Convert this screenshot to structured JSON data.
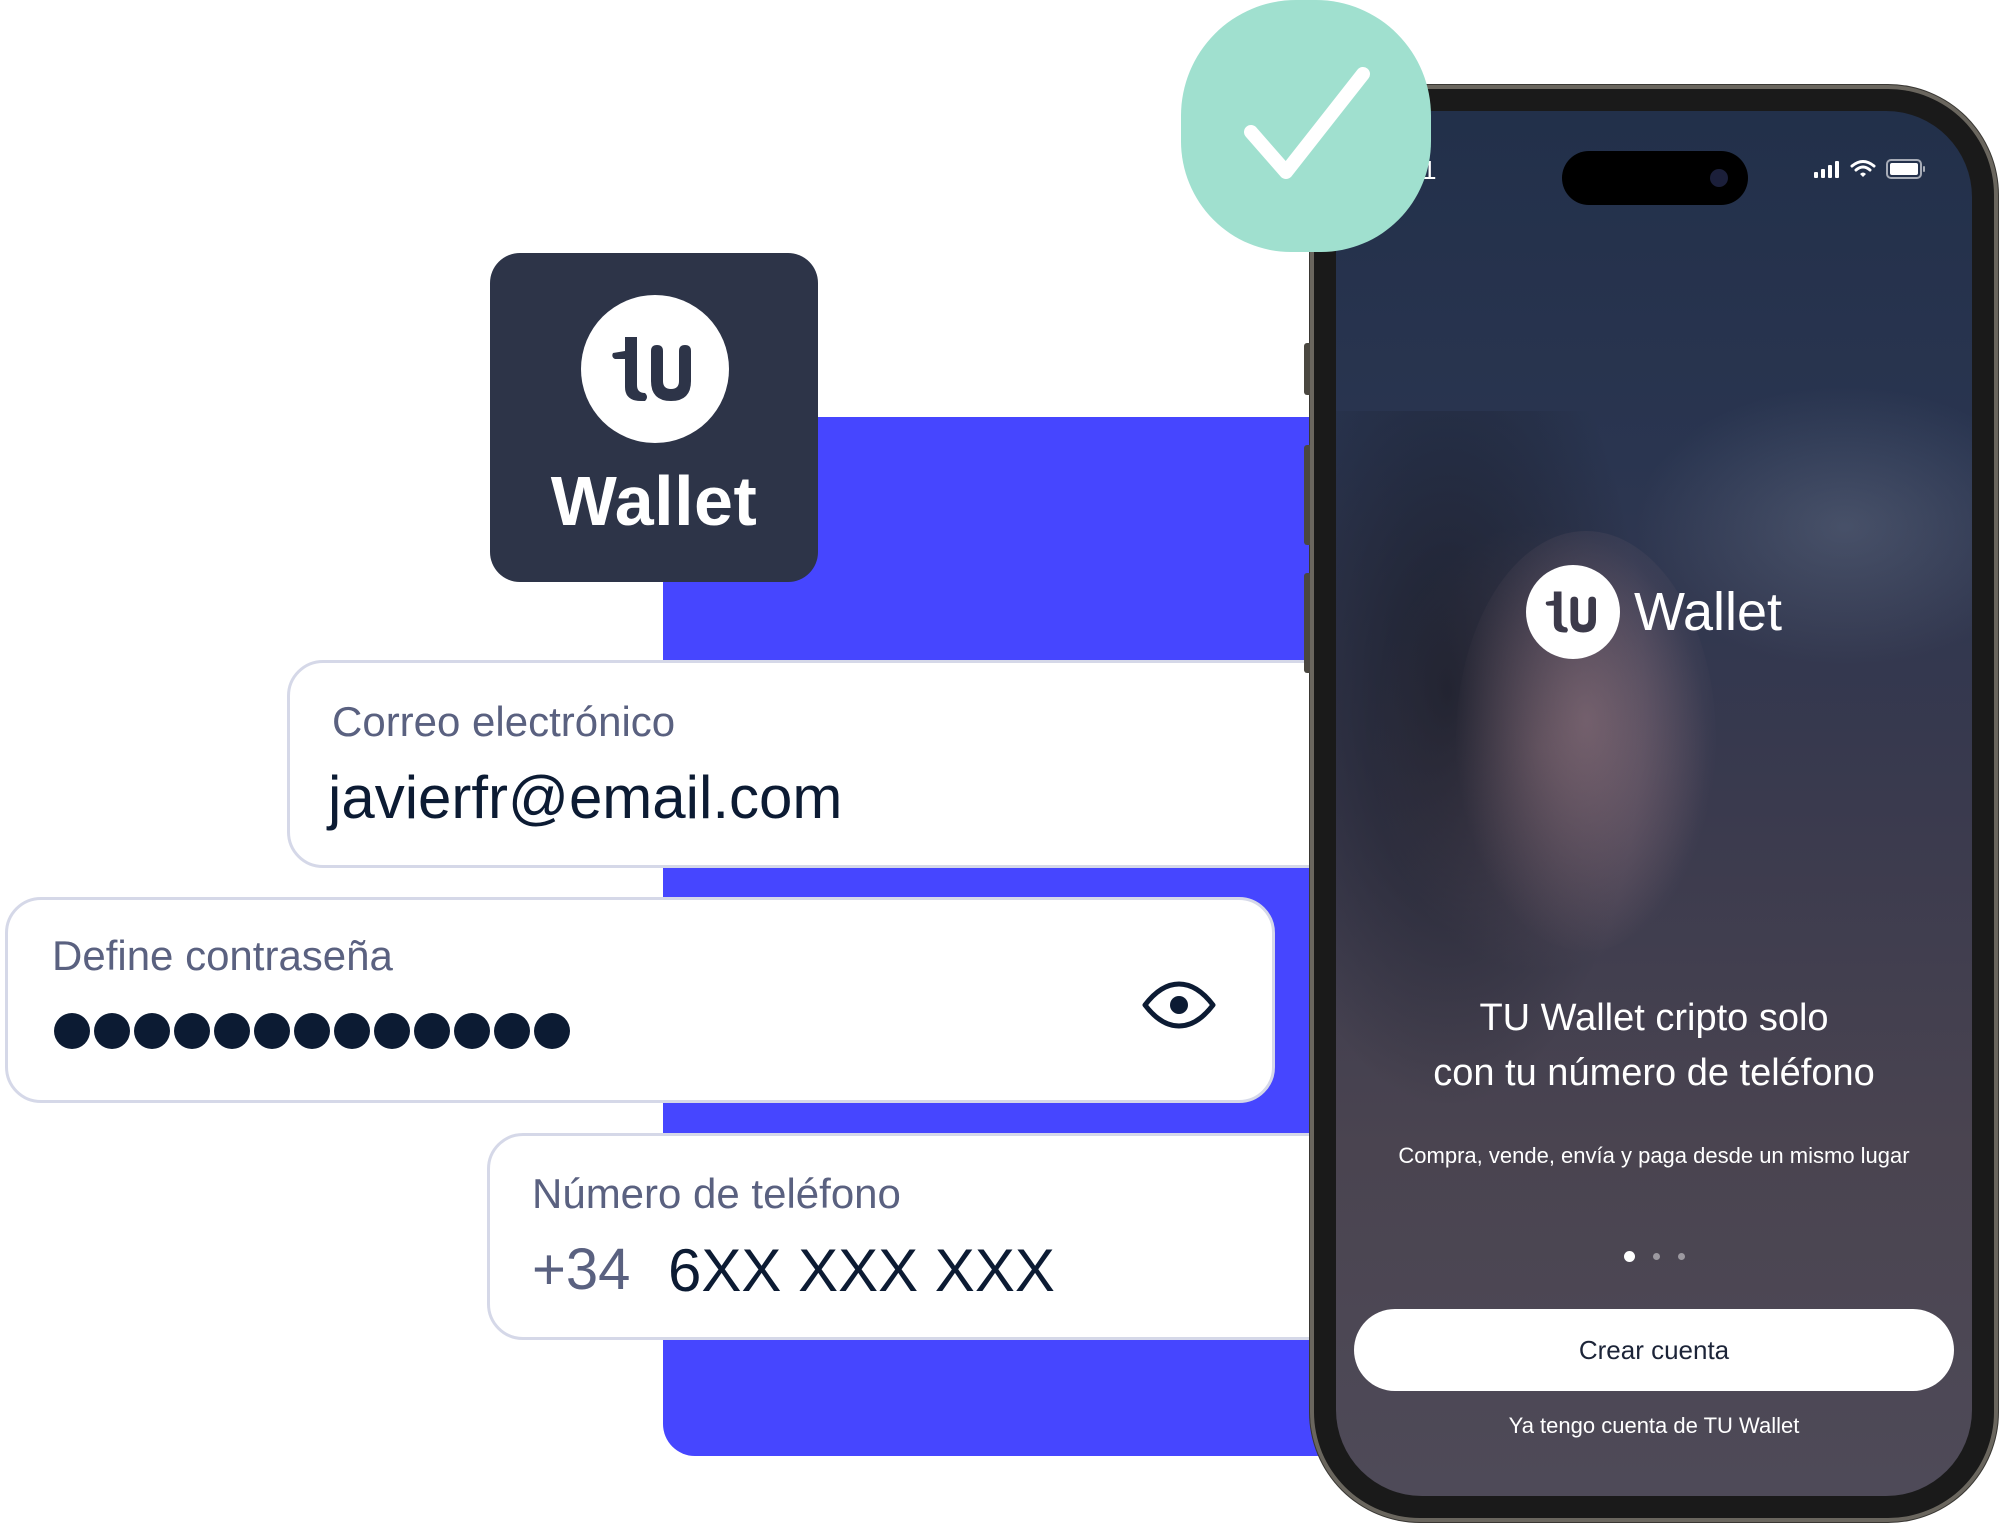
{
  "brand": {
    "logo_mark": "tu",
    "name": "Wallet"
  },
  "colors": {
    "accent_blue": "#4646ff",
    "tile_dark": "#2d3448",
    "success_mint": "#a0e0cf",
    "text_dark": "#0c1b33",
    "label_gray": "#5a6180"
  },
  "form": {
    "email": {
      "label": "Correo electrónico",
      "value": "javierfr@email.com"
    },
    "password": {
      "label": "Define contraseña",
      "masked_length": 13,
      "toggle_icon": "eye-icon"
    },
    "phone": {
      "label": "Número de teléfono",
      "prefix": "+34",
      "value": "6XX XXX XXX"
    }
  },
  "badge": {
    "icon": "checkmark-icon"
  },
  "phone_screen": {
    "status_time_visible": "1",
    "status_icons": [
      "signal-icon",
      "wifi-icon",
      "battery-icon"
    ],
    "logo_mark": "tu",
    "logo_text": "Wallet",
    "headline_line1": "TU Wallet cripto solo",
    "headline_line2": "con tu número de teléfono",
    "subline": "Compra, vende, envía y paga desde un mismo lugar",
    "pager": {
      "total": 3,
      "active": 1
    },
    "primary_button": "Crear cuenta",
    "secondary_link": "Ya tengo cuenta de TU Wallet"
  }
}
